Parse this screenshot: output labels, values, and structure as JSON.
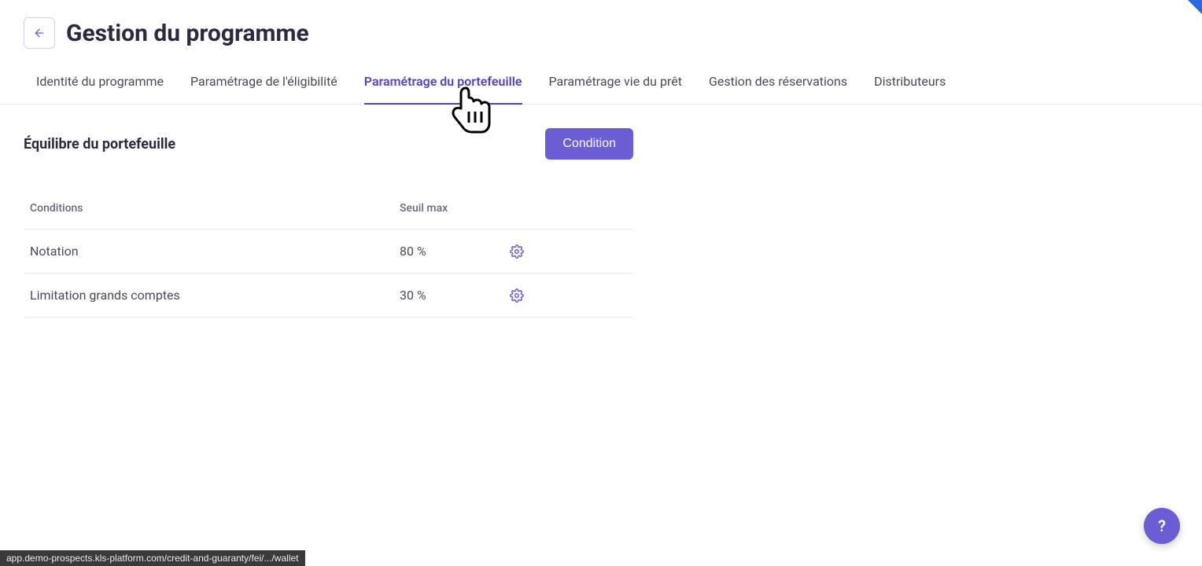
{
  "header": {
    "title": "Gestion du programme"
  },
  "tabs": [
    {
      "label": "Identité du programme",
      "active": false
    },
    {
      "label": "Paramétrage de l'éligibilité",
      "active": false
    },
    {
      "label": "Paramétrage du portefeuille",
      "active": true
    },
    {
      "label": "Paramétrage vie du prêt",
      "active": false
    },
    {
      "label": "Gestion des réservations",
      "active": false
    },
    {
      "label": "Distributeurs",
      "active": false
    }
  ],
  "section": {
    "title": "Équilibre du portefeuille",
    "button": "Condition"
  },
  "table": {
    "headers": {
      "conditions": "Conditions",
      "seuil": "Seuil max"
    },
    "rows": [
      {
        "condition": "Notation",
        "seuil": "80 %"
      },
      {
        "condition": "Limitation grands comptes",
        "seuil": "30 %"
      }
    ]
  },
  "status_bar": "app.demo-prospects.kls-platform.com/credit-and-guaranty/fei/.../wallet",
  "help": "?"
}
